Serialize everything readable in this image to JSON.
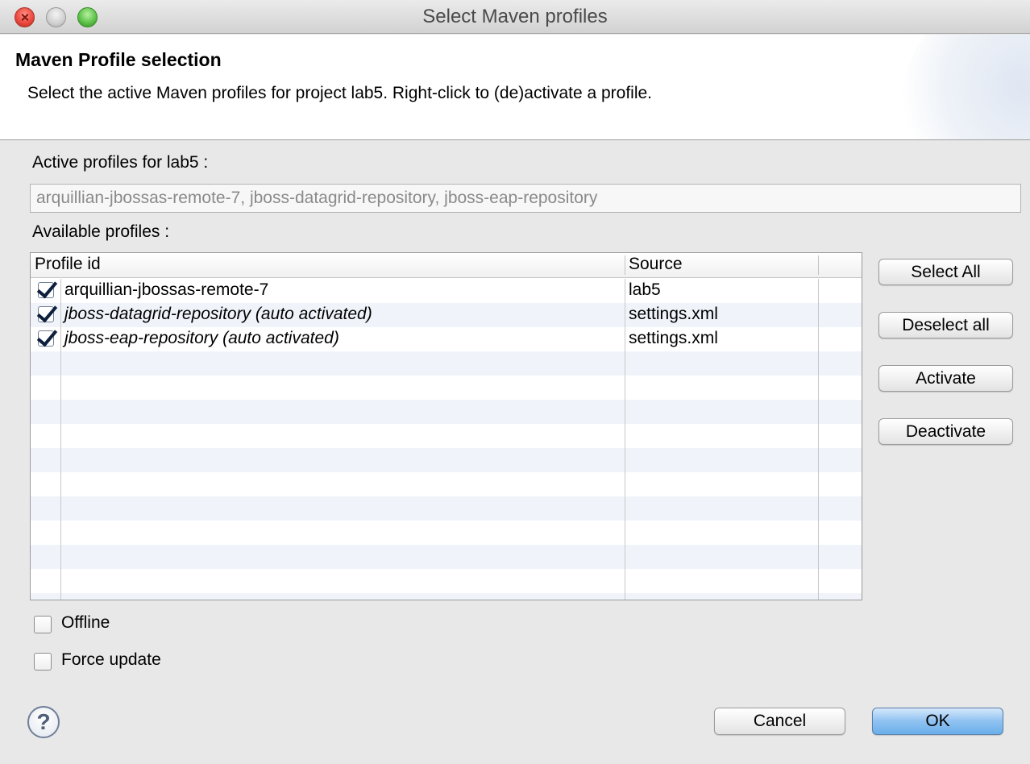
{
  "window": {
    "title": "Select Maven profiles"
  },
  "header": {
    "title": "Maven Profile selection",
    "description": "Select the active Maven profiles for project lab5. Right-click to (de)activate a profile."
  },
  "active_profiles": {
    "label": "Active profiles for lab5 :",
    "value": "arquillian-jbossas-remote-7, jboss-datagrid-repository, jboss-eap-repository"
  },
  "available_profiles": {
    "label": "Available profiles :",
    "columns": [
      "Profile id",
      "Source"
    ],
    "rows": [
      {
        "checked": true,
        "id": "arquillian-jbossas-remote-7",
        "source": "lab5",
        "italic": false
      },
      {
        "checked": true,
        "id": "jboss-datagrid-repository (auto activated)",
        "source": "settings.xml",
        "italic": true
      },
      {
        "checked": true,
        "id": "jboss-eap-repository (auto activated)",
        "source": "settings.xml",
        "italic": true
      }
    ]
  },
  "side_buttons": {
    "select_all": "Select All",
    "deselect_all": "Deselect all",
    "activate": "Activate",
    "deactivate": "Deactivate"
  },
  "options": {
    "offline": {
      "label": "Offline",
      "checked": false
    },
    "force_update": {
      "label": "Force update",
      "checked": false
    }
  },
  "footer": {
    "help_glyph": "?",
    "cancel": "Cancel",
    "ok": "OK"
  }
}
